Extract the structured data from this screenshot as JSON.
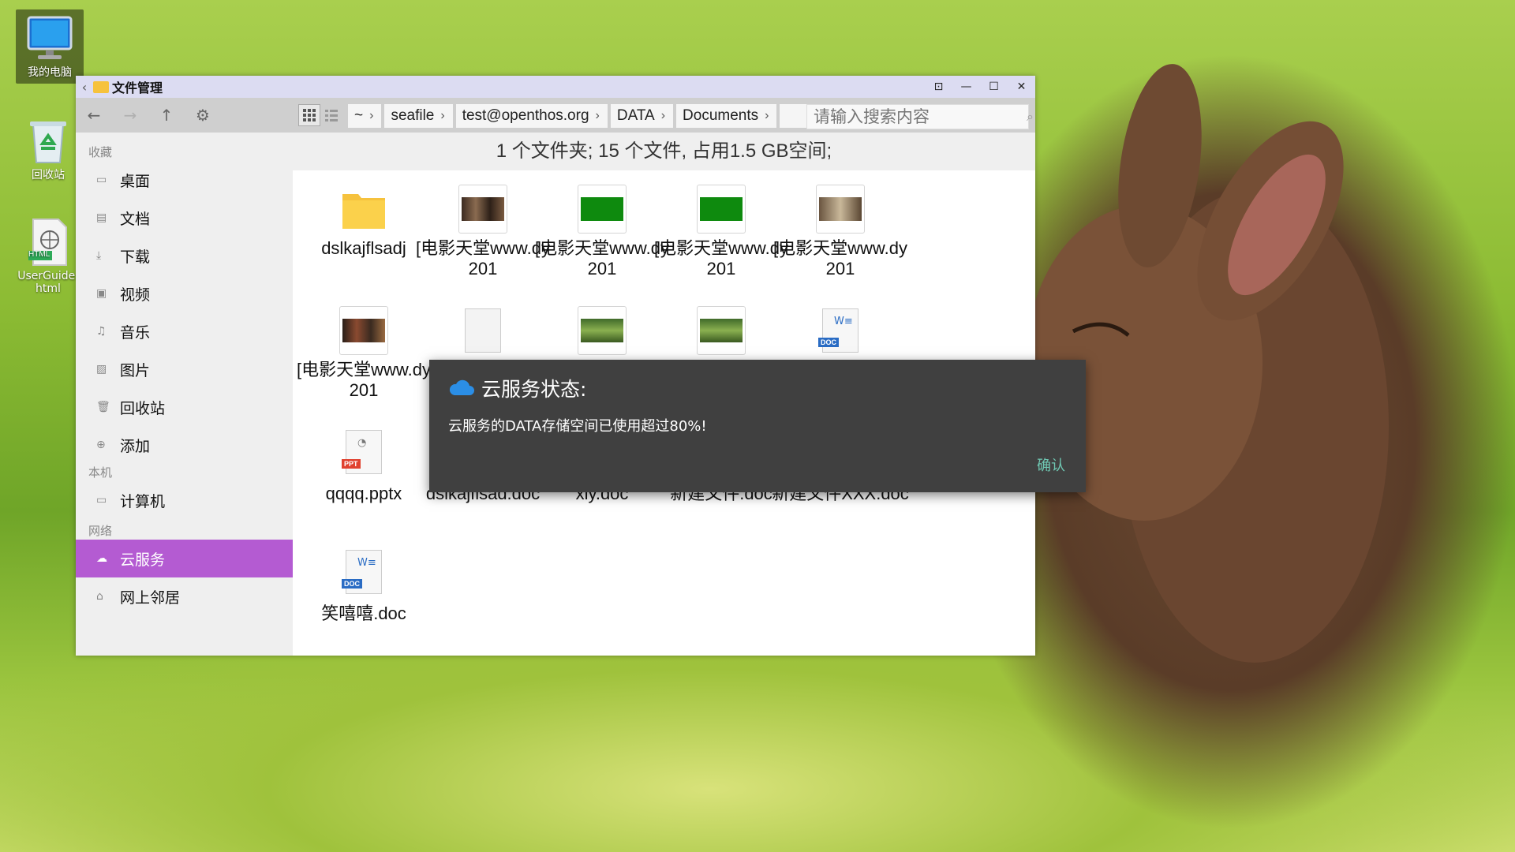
{
  "desktop": {
    "icons": [
      {
        "label": "我的电脑"
      },
      {
        "label": "回收站"
      },
      {
        "label": "UserGuide.html",
        "badge": "HTML"
      }
    ]
  },
  "window": {
    "title": "文件管理",
    "toolbar": {
      "breadcrumb": [
        "~",
        "seafile",
        "test@openthos.org",
        "DATA",
        "Documents"
      ],
      "search_placeholder": "请输入搜索内容"
    },
    "sidebar": {
      "sections": [
        {
          "title": "收藏",
          "items": [
            "桌面",
            "文档",
            "下载",
            "视频",
            "音乐",
            "图片",
            "回收站",
            "添加"
          ]
        },
        {
          "title": "本机",
          "items": [
            "计算机"
          ]
        },
        {
          "title": "网络",
          "items": [
            "云服务",
            "网上邻居"
          ]
        }
      ],
      "active_item": "云服务"
    },
    "status": "1 个文件夹;  15 个文件, 占用1.5 GB空间;",
    "files": [
      {
        "name": "dslkajflsadj",
        "kind": "folder"
      },
      {
        "name": "[电影天堂www.dy201",
        "kind": "image"
      },
      {
        "name": "[电影天堂www.dy201",
        "kind": "image"
      },
      {
        "name": "[电影天堂www.dy201",
        "kind": "image"
      },
      {
        "name": "[电影天堂www.dy201",
        "kind": "image"
      },
      {
        "name": "[电影天堂www.dy201",
        "kind": "image"
      },
      {
        "name": "",
        "kind": "blank"
      },
      {
        "name": "",
        "kind": "image"
      },
      {
        "name": "",
        "kind": "image"
      },
      {
        "name": "",
        "kind": "doc"
      },
      {
        "name": "qqqq.pptx",
        "kind": "ppt"
      },
      {
        "name": "dslkajflsad.doc",
        "kind": "doc"
      },
      {
        "name": "xly.doc",
        "kind": "doc"
      },
      {
        "name": "新建文件.doc",
        "kind": "doc"
      },
      {
        "name": "新建文件XXX.doc",
        "kind": "doc"
      },
      {
        "name": "笑嘻嘻.doc",
        "kind": "doc"
      }
    ]
  },
  "dialog": {
    "title": "云服务状态:",
    "message": "云服务的DATA存储空间已使用超过80%!",
    "confirm": "确认"
  },
  "colors": {
    "sidebar_active": "#b45bd2",
    "titlebar": "#dcdcf2",
    "dialog_bg": "#404040",
    "dialog_button": "#6fc7b2"
  }
}
